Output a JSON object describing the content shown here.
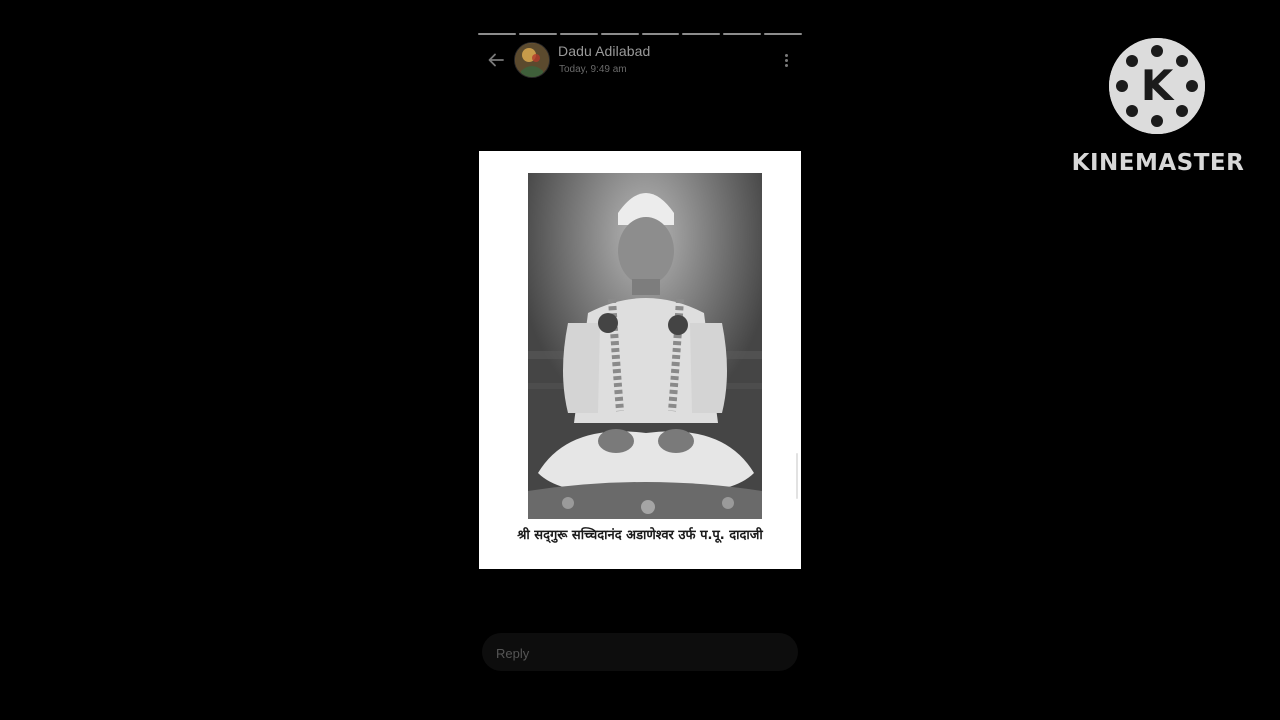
{
  "status": {
    "progress": {
      "segments": 8,
      "completed": 8
    },
    "header": {
      "contact_name": "Dadu Adilabad",
      "timestamp": "Today, 9:49 am",
      "back_icon": "arrow-left-icon",
      "menu_icon": "more-vertical-icon"
    },
    "media": {
      "caption": "श्री सद्‌गुरू सच्चिदानंद अडाणेश्वर उर्फ प.पू. दादाजी"
    },
    "reply": {
      "placeholder": "Reply",
      "value": ""
    }
  },
  "watermark": {
    "brand": "KINEMASTER",
    "logo_letter": "K"
  }
}
